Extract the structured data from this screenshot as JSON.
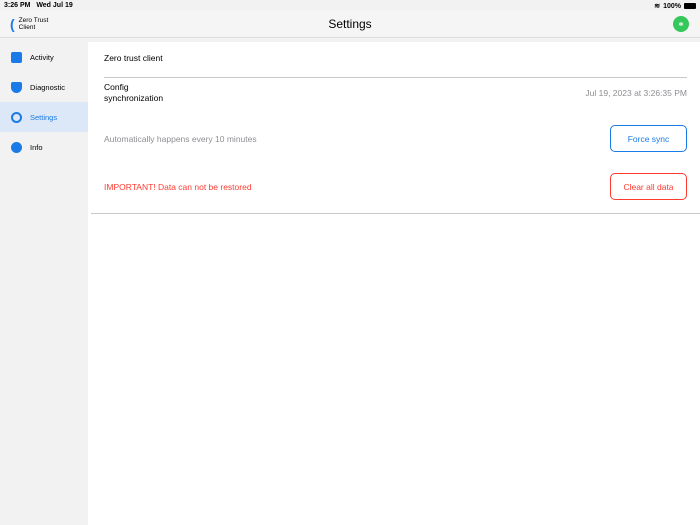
{
  "status": {
    "time": "3:26 PM",
    "date": "Wed Jul 19",
    "battery": "100%"
  },
  "header": {
    "app_name_1": "Zero Trust",
    "app_name_2": "Client",
    "title": "Settings"
  },
  "sidebar": {
    "items": [
      {
        "label": "Activity"
      },
      {
        "label": "Diagnostic"
      },
      {
        "label": "Settings"
      },
      {
        "label": "Info"
      }
    ]
  },
  "main": {
    "section_title": "Zero trust client",
    "config_label_1": "Config",
    "config_label_2": "synchronization",
    "last_sync": "Jul 19, 2023 at 3:26:35 PM",
    "auto_text": "Automatically happens every 10 minutes",
    "force_sync": "Force sync",
    "warning": "IMPORTANT! Data can not be restored",
    "clear_data": "Clear all data"
  },
  "colors": {
    "accent": "#1a7ae8",
    "danger": "#ff3b30",
    "success": "#34c759"
  }
}
